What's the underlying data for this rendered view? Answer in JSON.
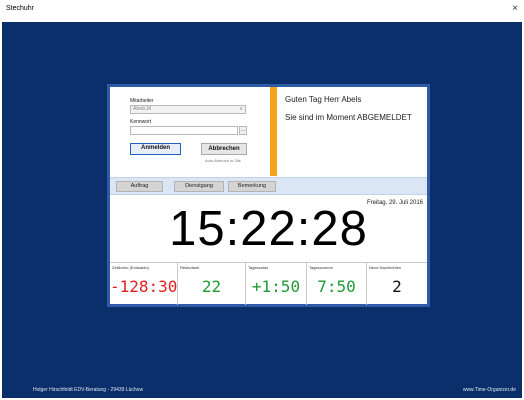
{
  "window": {
    "title": "Stechuhr",
    "close_glyph": "×"
  },
  "login": {
    "employee_label": "Mitarbeiter",
    "employee_value": "Abels,M",
    "password_label": "Kennwort",
    "password_value": "",
    "browse_label": "...",
    "login_button": "Anmelden",
    "cancel_button": "Abbrechen",
    "auto_logout_note": "Auto Abbruch in 28s"
  },
  "greeting": {
    "line1": "Guten Tag Herr Abels",
    "line2": "Sie sind im Moment ABGEMELDET"
  },
  "tabs": [
    {
      "label": "Auftrag"
    },
    {
      "label": "Dienstgang"
    },
    {
      "label": "Bemerkung"
    }
  ],
  "date": "Freitag, 29. Juli 2016",
  "time": "15:22:28",
  "stats": [
    {
      "caption": "Zeitkonto (Endsaldo)",
      "value": "-128:30",
      "color": "#e02020"
    },
    {
      "caption": "Resturlaub",
      "value": "22",
      "color": "#1f9a35"
    },
    {
      "caption": "Tagessaldo",
      "value": "+1:50",
      "color": "#1f9a35"
    },
    {
      "caption": "Tagessumme",
      "value": "7:50",
      "color": "#1f9a35"
    },
    {
      "caption": "Neue Nachrichten",
      "value": "2",
      "color": "#111111"
    }
  ],
  "footer": {
    "left": "Holger Hirschfeldt EDV-Beratung - 29439 Lüchow",
    "right": "www.Time-Organizer.de"
  },
  "colors": {
    "desktop": "#0b2f6b",
    "panel_border": "#2f5aa8",
    "accent_bar": "#f6a21a"
  }
}
